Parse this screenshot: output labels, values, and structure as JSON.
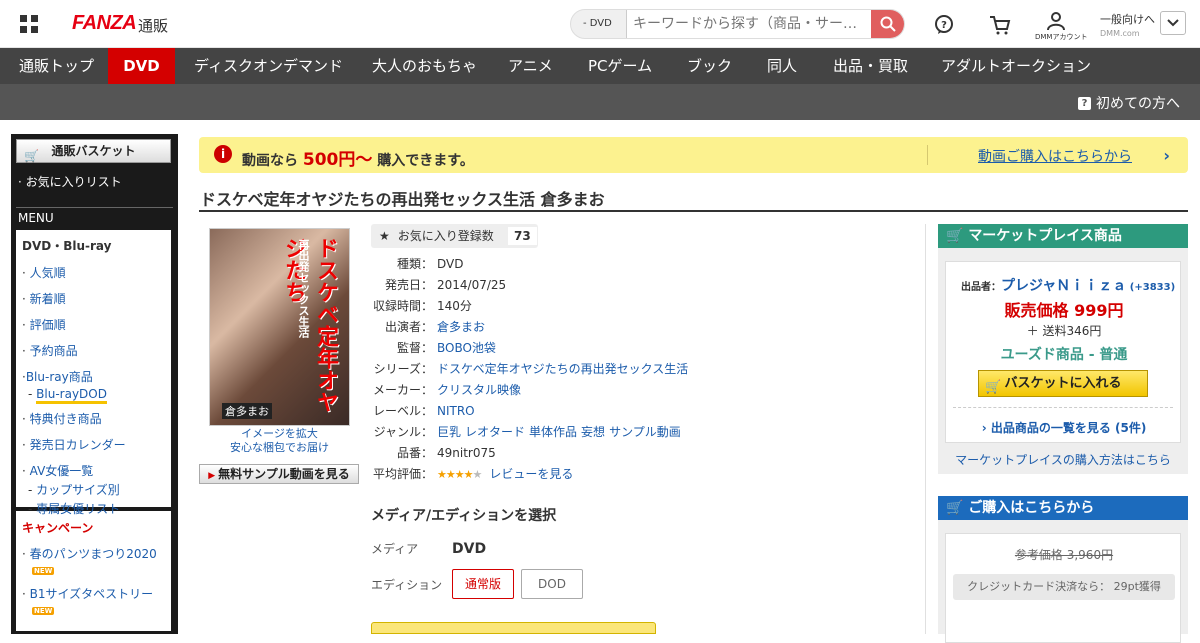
{
  "header": {
    "logo": "FANZA",
    "logo_sub": "通販",
    "search_category": "- DVD",
    "search_placeholder": "キーワードから探す（商品・サー…",
    "account_label": "DMMアカウント",
    "general_label": "一般向けへ",
    "general_sub": "DMM.com"
  },
  "nav": {
    "items": [
      "通販トップ",
      "DVD",
      "ディスクオンデマンド",
      "大人のおもちゃ",
      "アニメ",
      "PCゲーム",
      "ブック",
      "同人",
      "出品・買取",
      "アダルトオークション"
    ],
    "active_index": 1,
    "first_time": "初めての方へ"
  },
  "sidebar": {
    "basket": "通販バスケット",
    "favorites": "· お気に入りリスト",
    "menu_title": "MENU",
    "menu_heading": "DVD・Blu-ray",
    "menu_items": [
      "人気順",
      "新着順",
      "評価順",
      "予約商品",
      "Blu-ray商品"
    ],
    "bluray_dod": "Blu-rayDOD",
    "menu_items2": [
      "特典付き商品",
      "発売日カレンダー",
      "AV女優一覧"
    ],
    "actress_subs": [
      "カップサイズ別",
      "専属女優リスト"
    ],
    "campaign_title": "キャンペーン",
    "campaigns": [
      "春のパンツまつり2020",
      "B1サイズタペストリー"
    ],
    "new_badge": "NEW"
  },
  "banner": {
    "prefix": "動画なら",
    "price": "500円～",
    "suffix": "購入できます。",
    "link": "動画ご購入はこちらから"
  },
  "product": {
    "title": "ドスケベ定年オヤジたちの再出発セックス生活 倉多まお",
    "package_title": "ドスケベ定年オヤジたち",
    "package_sub": "再出発セックス生活",
    "package_name": "倉多まお",
    "image_caption1": "イメージを拡大",
    "image_caption2": "安心な梱包でお届け",
    "sample_button": "無料サンプル動画を見る",
    "fav_label": "お気に入り登録数",
    "fav_count": "73",
    "rating": 4,
    "info": {
      "type_k": "種類：",
      "type_v": "DVD",
      "release_k": "発売日：",
      "release_v": "2014/07/25",
      "time_k": "収録時間：",
      "time_v": "140分",
      "cast_k": "出演者：",
      "cast_v": "倉多まお",
      "director_k": "監督：",
      "director_v": "BOBO池袋",
      "series_k": "シリーズ：",
      "series_v": "ドスケベ定年オヤジたちの再出発セックス生活",
      "maker_k": "メーカー：",
      "maker_v": "クリスタル映像",
      "label_k": "レーベル：",
      "label_v": "NITRO",
      "genre_k": "ジャンル：",
      "genres": [
        "巨乳",
        "レオタード",
        "単体作品",
        "妄想",
        "サンプル動画"
      ],
      "number_k": "品番：",
      "number_v": "49nitr075",
      "review_k": "平均評価：",
      "review_link": "レビューを見る"
    },
    "media_title": "メディア/エディションを選択",
    "media_k": "メディア",
    "media_v": "DVD",
    "edition_k": "エディション",
    "editions": [
      "通常版",
      "DOD"
    ]
  },
  "marketplace": {
    "head": "マーケットプレイス商品",
    "seller_label": "出品者：",
    "seller_name": "プレジャＮｉｉｚａ",
    "seller_score": "(+3833)",
    "price": "販売価格 999円",
    "shipping": "＋ 送料346円",
    "condition": "ユーズド商品 - 普通",
    "basket_button": "バスケットに入れる",
    "list_link": "出品商品の一覧を見る (5件)",
    "howto": "マーケットプレイスの購入方法はこちら"
  },
  "purchase": {
    "head": "ご購入はこちらから",
    "ref_price": "参考価格 3,960円",
    "credit": "クレジットカード決済なら： 29pt獲得"
  }
}
